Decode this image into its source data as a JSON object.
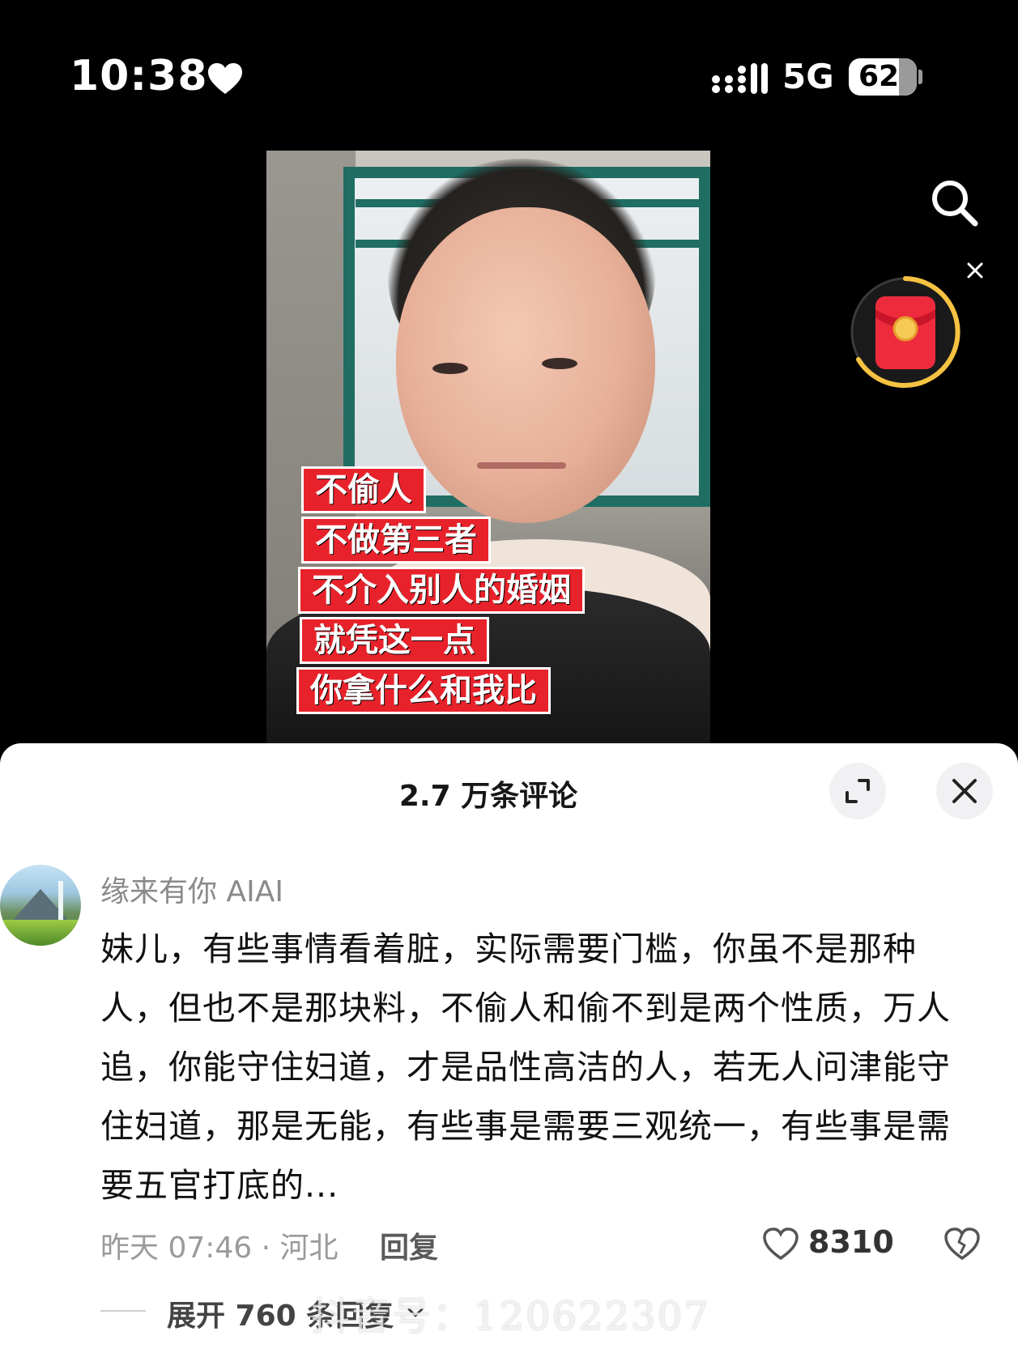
{
  "status_bar": {
    "time": "10:38",
    "network": "5G",
    "battery": "62"
  },
  "video": {
    "captions": [
      "不偷人",
      "不做第三者",
      "不介入别人的婚姻",
      "就凭这一点",
      "你拿什么和我比"
    ],
    "caption_color": "#e8222b"
  },
  "icons": {
    "search": "search-icon",
    "close": "close-icon",
    "red_packet": "red-packet-icon",
    "expand": "expand-icon",
    "like": "heart-icon",
    "dislike": "broken-heart-icon"
  },
  "comments_panel": {
    "title": "2.7 万条评论"
  },
  "comment": {
    "user": "缘来有你 AIAI",
    "text": "妹儿，有些事情看着脏，实际需要门槛，你虽不是那种人，但也不是那块料，不偷人和偷不到是两个性质，万人追，你能守住妇道，才是品性高洁的人，若无人问津能守住妇道，那是无能，有些事是需要三观统一，有些事是需要五官打底的...",
    "time_location": "昨天 07:46 · 河北",
    "reply_label": "回复",
    "likes": "8310",
    "expand_label": "展开 760 条回复"
  },
  "watermark": "抖音号：120622307"
}
